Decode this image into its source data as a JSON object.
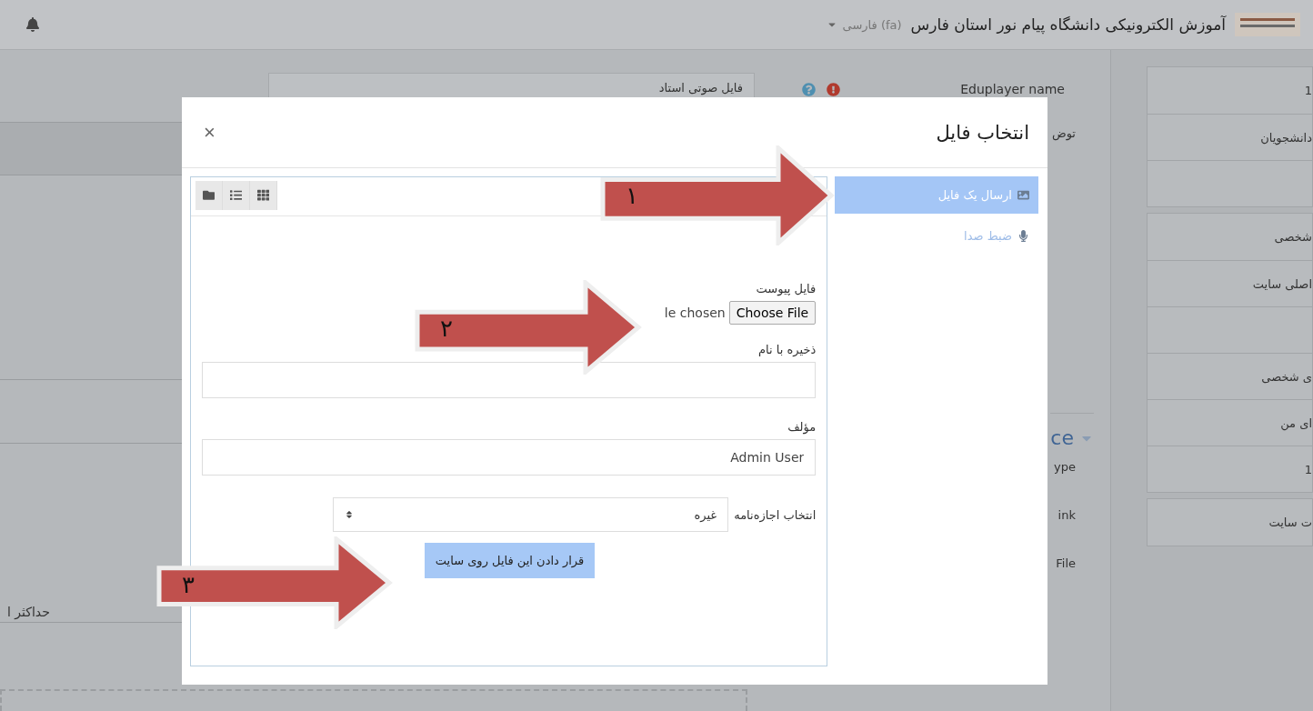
{
  "header": {
    "title": "آموزش الکترونیکی دانشگاه پیام نور استان فارس",
    "language": "فارسی (fa)"
  },
  "form": {
    "name_label": "Eduplayer name",
    "name_value": "فایل صوتی استاد",
    "name_required": true,
    "description_label": "توض",
    "section_heading": "ce",
    "row_labels": [
      "ype",
      "ink",
      "File"
    ],
    "left_label": "حداکثر ا"
  },
  "sidebar": {
    "groups": [
      {
        "items": [
          {
            "kind": "text",
            "label": "1"
          },
          {
            "kind": "text",
            "label": "دانشجویان"
          },
          {
            "kind": "blank"
          }
        ]
      },
      {
        "items": [
          {
            "kind": "text",
            "label": "شخصی"
          },
          {
            "kind": "text",
            "label": "اصلی سایت"
          },
          {
            "kind": "blank"
          },
          {
            "kind": "text",
            "label": "ی شخصی"
          },
          {
            "kind": "text",
            "label": "ای من"
          },
          {
            "kind": "text",
            "label": "1"
          }
        ]
      },
      {
        "items": [
          {
            "kind": "text",
            "label": "ت سایت"
          }
        ]
      }
    ]
  },
  "modal": {
    "title": "انتخاب فایل",
    "close": "×",
    "sources": [
      {
        "kind": "upload",
        "label": "ارسال یک فایل",
        "selected": true
      },
      {
        "kind": "record",
        "label": "ضبط صدا",
        "selected": false
      }
    ],
    "upload_form": {
      "file_label": "فایل پیوست",
      "file_status": "le chosen",
      "choose_button": "Choose File",
      "save_as_label": "ذخیره با نام",
      "author_label": "مؤلف",
      "author_value": "Admin User",
      "license_label": "انتخاب اجازه‌نامه",
      "license_value": "غیره",
      "submit": "قرار دادن این فایل روی سایت"
    }
  },
  "annotations": [
    {
      "number": "۱"
    },
    {
      "number": "۲"
    },
    {
      "number": "۳"
    }
  ]
}
